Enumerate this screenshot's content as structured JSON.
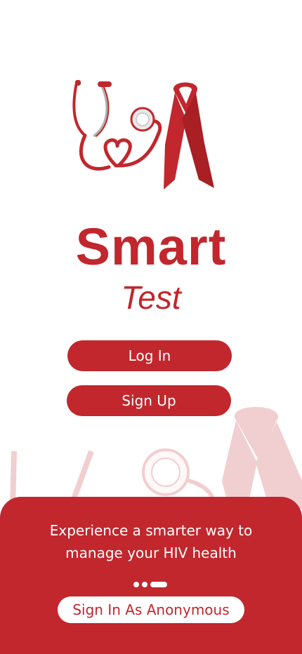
{
  "brand": {
    "title": "Smart",
    "subtitle": "Test",
    "color": "#c1272d"
  },
  "buttons": {
    "login": "Log In",
    "signup": "Sign Up",
    "anonymous": "Sign In As Anonymous"
  },
  "panel": {
    "tagline_line1": "Experience a smarter way to",
    "tagline_line2": "manage your HIV health",
    "pager": {
      "pages": 3,
      "active_index": 2
    }
  },
  "icons": [
    "stethoscope-heart-icon",
    "awareness-ribbon-icon"
  ]
}
